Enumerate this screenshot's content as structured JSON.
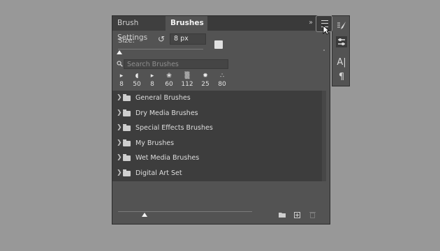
{
  "tabs": [
    {
      "label": "Brush Settings",
      "active": false
    },
    {
      "label": "Brushes",
      "active": true
    }
  ],
  "size": {
    "label": "Size:",
    "value": "8 px",
    "slider_fraction": 0.02
  },
  "search": {
    "placeholder": "Search Brushes",
    "value": ""
  },
  "recent_brushes": [
    {
      "size": "8",
      "icon": "brush-tip-icon"
    },
    {
      "size": "50",
      "icon": "brush-tip-icon"
    },
    {
      "size": "8",
      "icon": "brush-tip-icon"
    },
    {
      "size": "60",
      "icon": "brush-tip-icon"
    },
    {
      "size": "112",
      "icon": "brush-tip-icon"
    },
    {
      "size": "25",
      "icon": "brush-tip-icon"
    },
    {
      "size": "80",
      "icon": "brush-tip-icon"
    }
  ],
  "brush_groups": [
    {
      "label": "General Brushes"
    },
    {
      "label": "Dry Media Brushes"
    },
    {
      "label": "Special Effects Brushes"
    },
    {
      "label": "My Brushes"
    },
    {
      "label": "Wet Media Brushes"
    },
    {
      "label": "Digital Art Set"
    }
  ],
  "preview_slider_fraction": 0.2,
  "colors": {
    "background": "#989898",
    "panel": "#535353",
    "list": "#3d3d3d",
    "text": "#d8d8d8"
  },
  "icons": {
    "collapse": "double-chevron-right-icon",
    "panel_menu": "panel-menu-icon",
    "reset": "reset-size-icon",
    "new_preset": "new-preset-icon",
    "search": "search-icon",
    "folder": "folder-icon",
    "new_group": "new-group-icon",
    "new_brush": "new-brush-icon",
    "delete": "trash-icon",
    "strip": [
      "brush-settings-icon",
      "brushes-icon",
      "character-icon",
      "paragraph-icon"
    ]
  }
}
